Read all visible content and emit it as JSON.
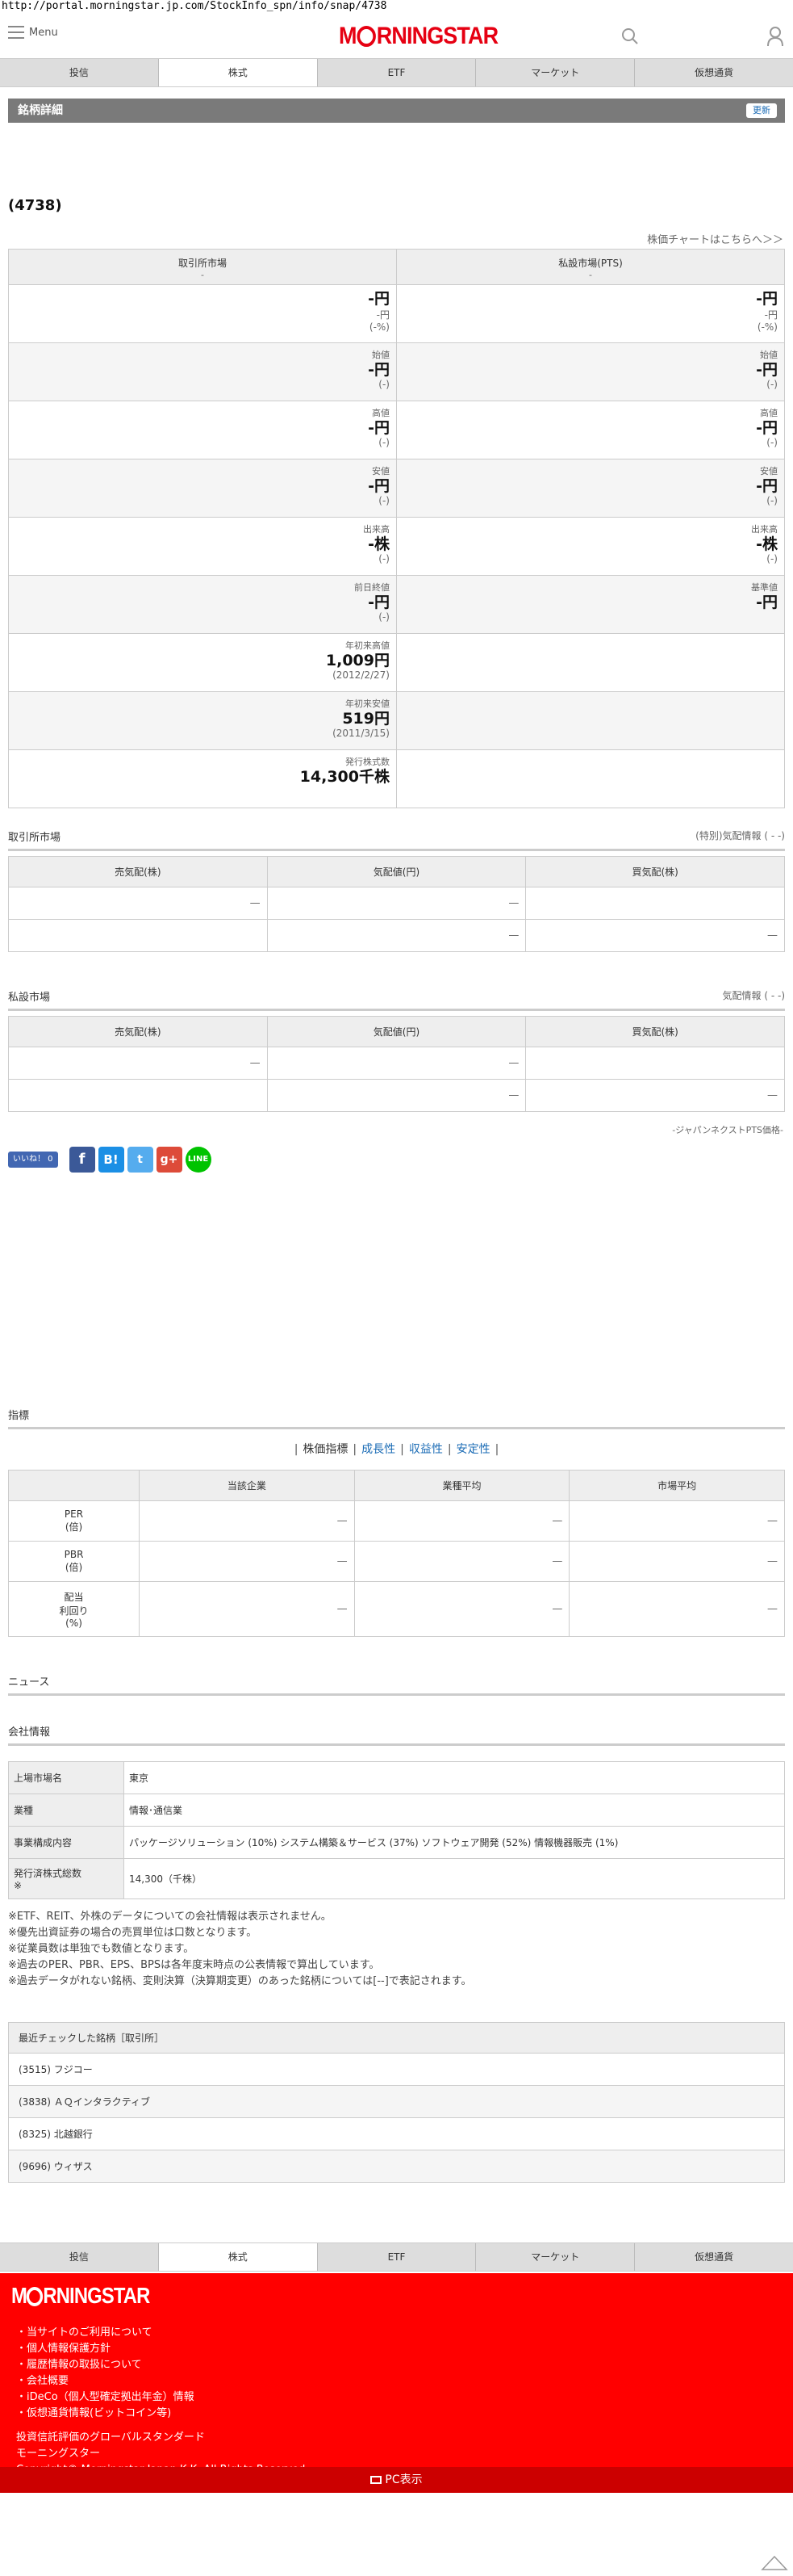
{
  "url": "http://portal.morningstar.jp.com/StockInfo_spn/info/snap/4738",
  "header": {
    "menu_label": "Menu",
    "logo_pre": "M",
    "logo_post": "RNINGSTAR"
  },
  "tabs": [
    "投信",
    "株式",
    "ETF",
    "マーケット",
    "仮想通貨"
  ],
  "active_tab": "株式",
  "detail": {
    "title": "銘柄詳細",
    "refresh": "更新",
    "code": "(4738)",
    "chart_link": "株価チャートはこちらへ＞＞"
  },
  "quote": {
    "col1": {
      "title": "取引所市場",
      "sub": "-"
    },
    "col2": {
      "title": "私設市場(PTS)",
      "sub": "-"
    },
    "rows": [
      {
        "l_label": "",
        "l_val": "-円",
        "l_s1": "-円",
        "l_s2": "(-%)",
        "r_label": "",
        "r_val": "-円",
        "r_s1": "-円",
        "r_s2": "(-%)"
      },
      {
        "l_label": "始値",
        "l_val": "-円",
        "l_s1": "(-)",
        "l_s2": "",
        "r_label": "始値",
        "r_val": "-円",
        "r_s1": "(-)",
        "r_s2": ""
      },
      {
        "l_label": "高値",
        "l_val": "-円",
        "l_s1": "(-)",
        "l_s2": "",
        "r_label": "高値",
        "r_val": "-円",
        "r_s1": "(-)",
        "r_s2": ""
      },
      {
        "l_label": "安値",
        "l_val": "-円",
        "l_s1": "(-)",
        "l_s2": "",
        "r_label": "安値",
        "r_val": "-円",
        "r_s1": "(-)",
        "r_s2": ""
      },
      {
        "l_label": "出来高",
        "l_val": "-株",
        "l_s1": "(-)",
        "l_s2": "",
        "r_label": "出来高",
        "r_val": "-株",
        "r_s1": "(-)",
        "r_s2": ""
      },
      {
        "l_label": "前日終値",
        "l_val": "-円",
        "l_s1": "(-)",
        "l_s2": "",
        "r_label": "基準値",
        "r_val": "-円",
        "r_s1": "",
        "r_s2": ""
      },
      {
        "l_label": "年初来高値",
        "l_val": "1,009円",
        "l_s1": "(2012/2/27)",
        "l_s2": "",
        "r_label": "",
        "r_val": "",
        "r_s1": "",
        "r_s2": ""
      },
      {
        "l_label": "年初来安値",
        "l_val": "519円",
        "l_s1": "(2011/3/15)",
        "l_s2": "",
        "r_label": "",
        "r_val": "",
        "r_s1": "",
        "r_s2": ""
      },
      {
        "l_label": "発行株式数",
        "l_val": "14,300千株",
        "l_s1": "",
        "l_s2": "",
        "r_label": "",
        "r_val": "",
        "r_s1": "",
        "r_s2": ""
      }
    ]
  },
  "exchange_board": {
    "title": "取引所市場",
    "note": "(特別)気配情報 ( - -)",
    "headers": [
      "売気配(株)",
      "気配値(円)",
      "買気配(株)"
    ],
    "rows": [
      [
        "—",
        "—",
        ""
      ],
      [
        "",
        "—",
        "—"
      ]
    ]
  },
  "pts_board": {
    "title": "私設市場",
    "note": "気配情報 ( - -)",
    "headers": [
      "売気配(株)",
      "気配値(円)",
      "買気配(株)"
    ],
    "rows": [
      [
        "—",
        "—",
        ""
      ],
      [
        "",
        "—",
        "—"
      ]
    ],
    "source": "-ジャパンネクストPTS価格-"
  },
  "social": {
    "like": "いいね！ 0"
  },
  "indicators": {
    "title": "指標",
    "links": [
      "株価指標",
      "成長性",
      "収益性",
      "安定性"
    ],
    "headers": [
      "",
      "当該企業",
      "業種平均",
      "市場平均"
    ],
    "rows": [
      {
        "label": [
          "PER",
          "(倍)"
        ],
        "values": [
          "—",
          "—",
          "—"
        ]
      },
      {
        "label": [
          "PBR",
          "(倍)"
        ],
        "values": [
          "—",
          "—",
          "—"
        ]
      },
      {
        "label": [
          "配当",
          "利回り",
          "(%)"
        ],
        "values": [
          "—",
          "—",
          "—"
        ]
      }
    ]
  },
  "news": {
    "title": "ニュース"
  },
  "company": {
    "title": "会社情報",
    "rows": [
      {
        "k": "上場市場名",
        "v": "東京"
      },
      {
        "k": "業種",
        "v": "情報･通信業"
      },
      {
        "k": "事業構成内容",
        "v": "パッケージソリューション (10%) システム構築＆サービス (37%) ソフトウェア開発 (52%) 情報機器販売 (1%)"
      },
      {
        "k": "発行済株式総数\n※",
        "v": "14,300（千株）"
      }
    ],
    "notes": [
      "※ETF、REIT、外株のデータについての会社情報は表示されません。",
      "※優先出資証券の場合の売買単位は口数となります。",
      "※従業員数は単独でも数値となります。",
      "※過去のPER、PBR、EPS、BPSは各年度末時点の公表情報で算出しています。",
      "※過去データがれない銘柄、変則決算（決算期変更）のあった銘柄については[--]で表記されます。"
    ]
  },
  "recent": {
    "title": "最近チェックした銘柄［取引所］",
    "items": [
      "(3515) フジコー",
      "(3838) ＡＱインタラクティブ",
      "(8325) 北越銀行",
      "(9696) ウィザス"
    ]
  },
  "footer": {
    "links": [
      "・当サイトのご利用について",
      "・個人情報保護方針",
      "・履歴情報の取扱について",
      "・会社概要",
      "・iDeCo（個人型確定拠出年金）情報",
      "・仮想通貨情報(ビットコイン等)"
    ],
    "tagline1": "投資信託評価のグローバルスタンダード",
    "tagline2": "モーニングスター",
    "copyright": "Copyright© Morningstar Japan K.K. All Rights Reserved.",
    "pc_label": "PC表示"
  },
  "colors": {
    "brand": "#e60012",
    "link": "#1a6bb5"
  }
}
